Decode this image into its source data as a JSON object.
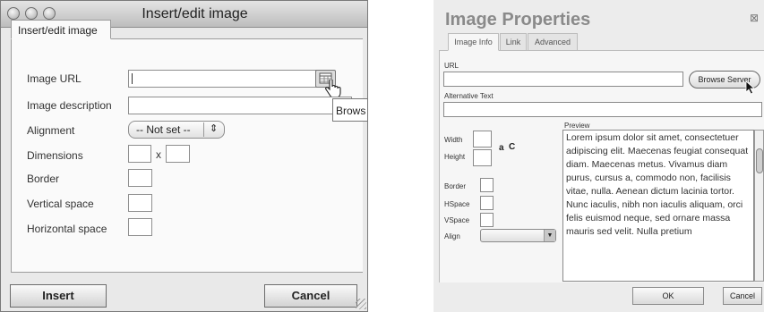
{
  "left_dialog": {
    "title": "Insert/edit image",
    "tab": "Insert/edit image",
    "labels": {
      "image_url": "Image URL",
      "image_description": "Image description",
      "alignment": "Alignment",
      "dimensions": "Dimensions",
      "border": "Border",
      "vertical_space": "Vertical space",
      "horizontal_space": "Horizontal space"
    },
    "dimensions_separator": "x",
    "alignment_value": "-- Not set --",
    "browse_tooltip": "Brows",
    "insert_button": "Insert",
    "cancel_button": "Cancel"
  },
  "right_dialog": {
    "title": "Image Properties",
    "close_glyph": "⊠",
    "tabs": [
      "Image Info",
      "Link",
      "Advanced"
    ],
    "url_label": "URL",
    "browse_button": "Browse Server",
    "alt_label": "Alternative Text",
    "width_label": "Width",
    "height_label": "Height",
    "lock_glyph": "a",
    "reset_glyph": "C",
    "border_label": "Border",
    "hspace_label": "HSpace",
    "vspace_label": "VSpace",
    "align_label": "Align",
    "preview_label": "Preview",
    "preview_text": "Lorem ipsum dolor sit amet, consectetuer adipiscing elit. Maecenas feugiat consequat diam. Maecenas metus. Vivamus diam purus, cursus a, commodo non, facilisis vitae, nulla. Aenean dictum lacinia tortor. Nunc iaculis, nibh non iaculis aliquam, orci felis euismod neque, sed ornare massa mauris sed velit. Nulla pretium",
    "ok_button": "OK",
    "cancel_button": "Cancel"
  }
}
